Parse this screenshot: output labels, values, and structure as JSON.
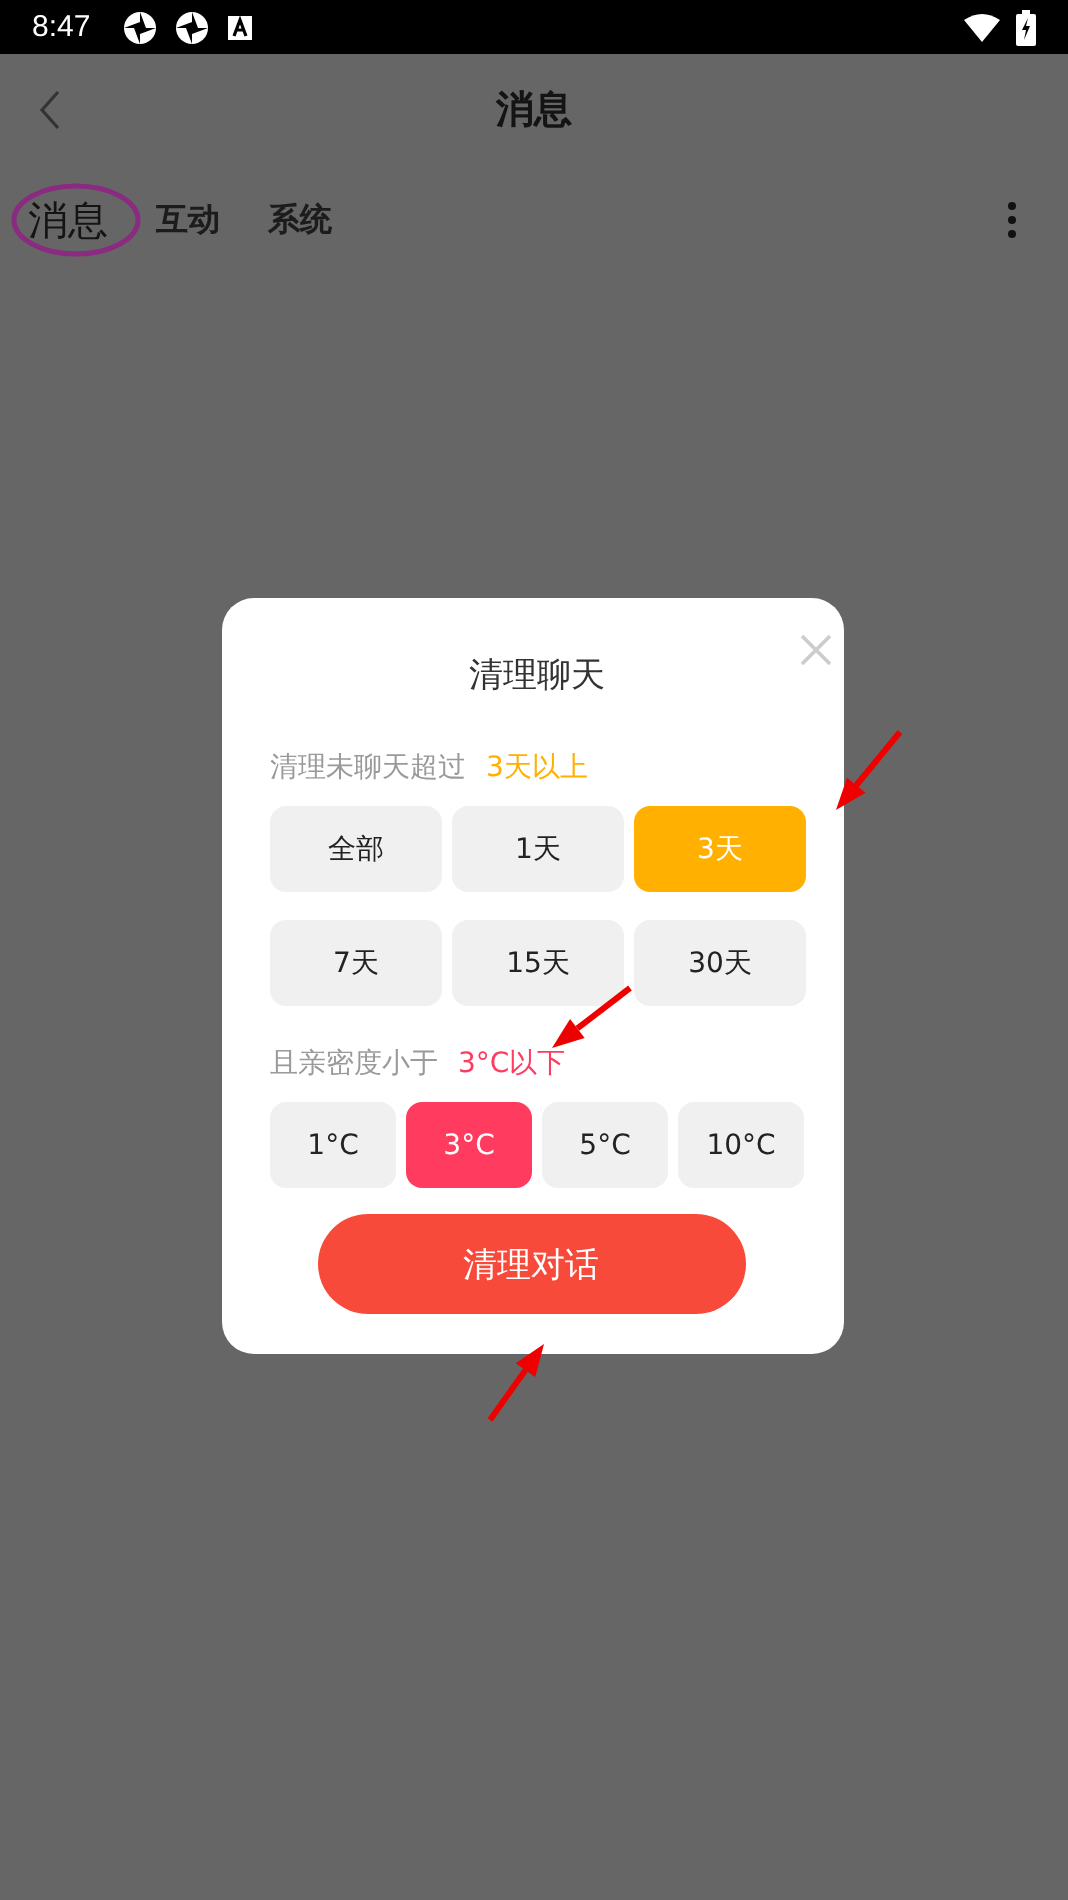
{
  "status_bar": {
    "time": "8:47"
  },
  "header": {
    "title": "消息"
  },
  "tabs": [
    {
      "label": "消息",
      "selected": true
    },
    {
      "label": "互动",
      "selected": false
    },
    {
      "label": "系统",
      "selected": false
    }
  ],
  "dialog": {
    "title": "清理聊天",
    "filters": [
      {
        "label": "清理未聊天超过",
        "value": "3天以上",
        "color": "#ffb000",
        "options": [
          {
            "label": "全部",
            "selected": false
          },
          {
            "label": "1天",
            "selected": false
          },
          {
            "label": "3天",
            "selected": true
          },
          {
            "label": "7天",
            "selected": false
          },
          {
            "label": "15天",
            "selected": false
          },
          {
            "label": "30天",
            "selected": false
          }
        ]
      },
      {
        "label": "且亲密度小于",
        "value": "3°C以下",
        "color": "#ff3c5f",
        "options": [
          {
            "label": "1°C",
            "selected": false
          },
          {
            "label": "3°C",
            "selected": true
          },
          {
            "label": "5°C",
            "selected": false
          },
          {
            "label": "10°C",
            "selected": false
          }
        ]
      }
    ],
    "button": "清理对话"
  }
}
